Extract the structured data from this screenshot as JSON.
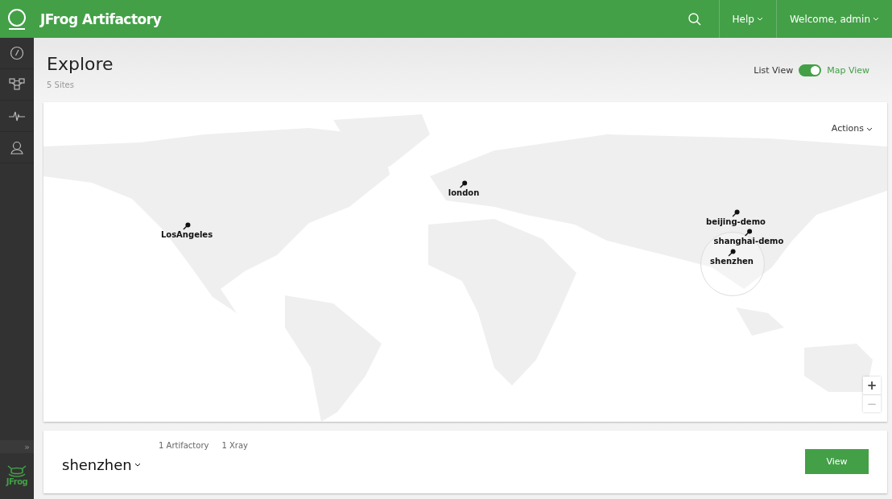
{
  "header": {
    "product": "JFrog Artifactory",
    "help": "Help",
    "user": "Welcome, admin"
  },
  "sidebar": {
    "logo_text": "JFrog",
    "expand": "»"
  },
  "page": {
    "title": "Explore",
    "subtitle": "5 Sites"
  },
  "view_toggle": {
    "left": "List View",
    "right": "Map View",
    "on": true
  },
  "map": {
    "actions": "Actions",
    "zoom_in": "+",
    "zoom_out": "−",
    "sites": [
      {
        "name": "LosAngeles"
      },
      {
        "name": "london"
      },
      {
        "name": "beijing-demo"
      },
      {
        "name": "shanghai-demo"
      },
      {
        "name": "shenzhen"
      }
    ]
  },
  "site_card": {
    "name": "shenzhen",
    "counts": [
      "1 Artifactory",
      "1 Xray"
    ],
    "button": "View"
  }
}
